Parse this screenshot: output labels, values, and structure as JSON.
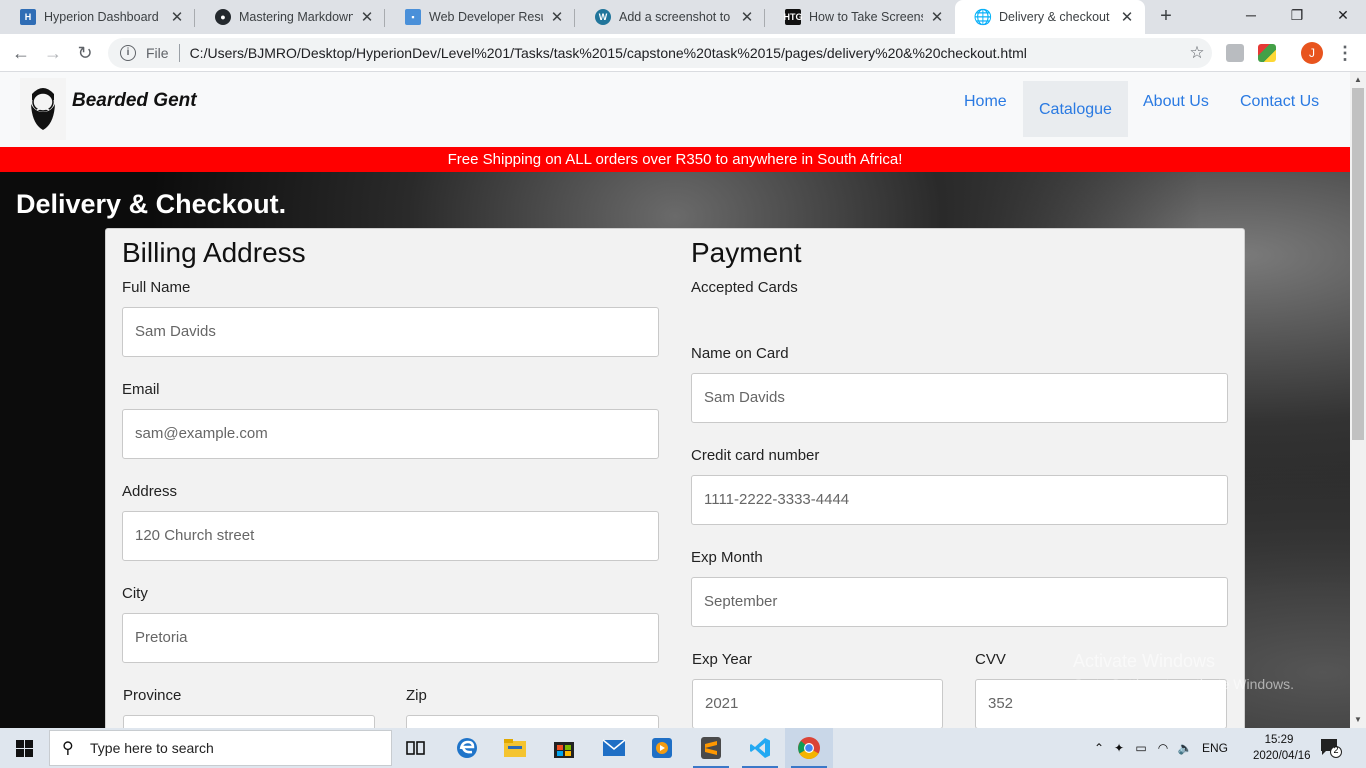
{
  "browser": {
    "tabs": [
      {
        "title": "Hyperion Dashboard",
        "favicon": "hyperion-icon"
      },
      {
        "title": "Mastering Markdown · G",
        "favicon": "github-icon"
      },
      {
        "title": "Web Developer Resume",
        "favicon": "resume-icon"
      },
      {
        "title": "Add a screenshot to yo",
        "favicon": "wordpress-icon"
      },
      {
        "title": "How to Take Screenshot",
        "favicon": "htg-icon"
      },
      {
        "title": "Delivery & checkout",
        "favicon": "globe-icon",
        "active": true
      }
    ],
    "address": {
      "scheme_label": "File",
      "url": "C:/Users/BJMRO/Desktop/HyperionDev/Level%201/Tasks/task%2015/capstone%20task%2015/pages/delivery%20&%20checkout.html"
    },
    "profile_initial": "J"
  },
  "site": {
    "brand": "Bearded Gent",
    "nav": [
      {
        "label": "Home"
      },
      {
        "label": "Catalogue",
        "active": true
      },
      {
        "label": "About Us"
      },
      {
        "label": "Contact Us"
      }
    ],
    "promo": "Free Shipping on ALL orders over R350 to anywhere in South Africa!",
    "heading": "Delivery & Checkout."
  },
  "billing": {
    "title": "Billing Address",
    "full_name": {
      "label": "Full Name",
      "placeholder": "Sam Davids"
    },
    "email": {
      "label": "Email",
      "placeholder": "sam@example.com"
    },
    "address": {
      "label": "Address",
      "placeholder": "120 Church street"
    },
    "city": {
      "label": "City",
      "placeholder": "Pretoria"
    },
    "province": {
      "label": "Province",
      "placeholder": ""
    },
    "zip": {
      "label": "Zip",
      "placeholder": ""
    }
  },
  "payment": {
    "title": "Payment",
    "accepted_cards_label": "Accepted Cards",
    "name_on_card": {
      "label": "Name on Card",
      "placeholder": "Sam Davids"
    },
    "card_number": {
      "label": "Credit card number",
      "placeholder": "1111-2222-3333-4444"
    },
    "exp_month": {
      "label": "Exp Month",
      "placeholder": "September"
    },
    "exp_year": {
      "label": "Exp Year",
      "placeholder": "2021"
    },
    "cvv": {
      "label": "CVV",
      "placeholder": "352"
    }
  },
  "watermark": {
    "line1": "Activate Windows",
    "line2": "Go to Settings to activate Windows."
  },
  "taskbar": {
    "search_placeholder": "Type here to search",
    "language": "ENG",
    "time": "15:29",
    "date": "2020/04/16",
    "notification_count": "2"
  }
}
